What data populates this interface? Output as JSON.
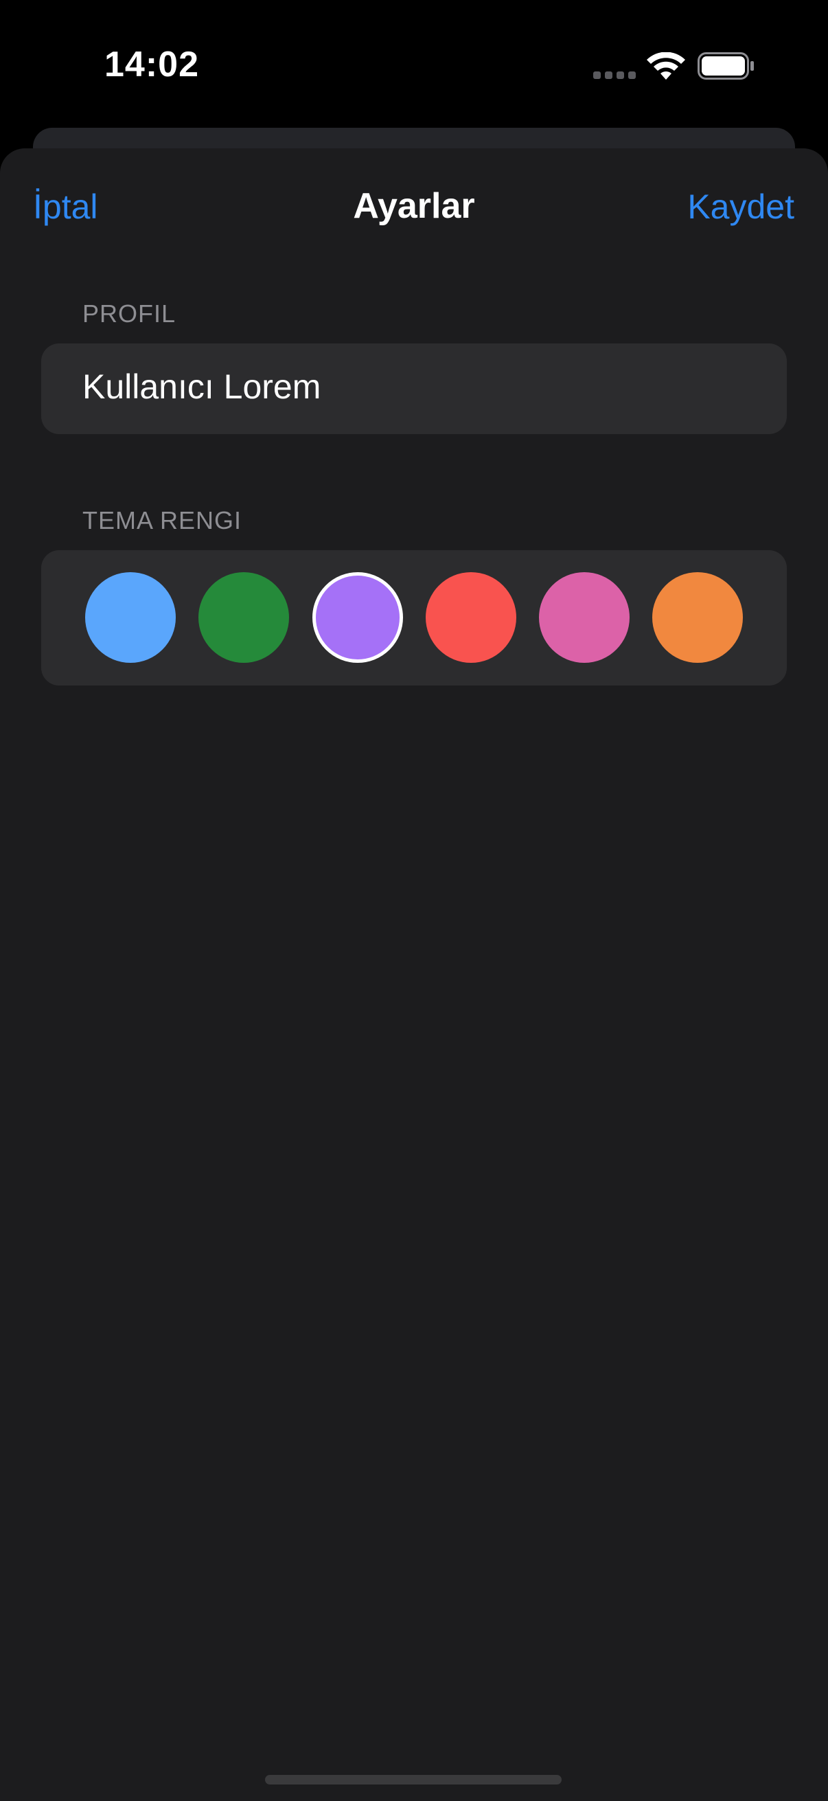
{
  "status_bar": {
    "time": "14:02",
    "signal_icon": "cellular-signal-icon",
    "wifi_icon": "wifi-icon",
    "battery_icon": "battery-icon"
  },
  "nav": {
    "cancel_label": "İptal",
    "title": "Ayarlar",
    "save_label": "Kaydet",
    "accent_color": "#2f88f2"
  },
  "profile": {
    "section_label": "PROFIL",
    "name_value": "Kullanıcı Lorem"
  },
  "theme": {
    "section_label": "TEMA RENGI",
    "selected_index": 2,
    "colors": [
      {
        "name": "blue",
        "hex": "#5aa6fc"
      },
      {
        "name": "green",
        "hex": "#258a3a"
      },
      {
        "name": "purple",
        "hex": "#a571f7"
      },
      {
        "name": "red",
        "hex": "#f9534f"
      },
      {
        "name": "pink",
        "hex": "#dc62a8"
      },
      {
        "name": "orange",
        "hex": "#f1883f"
      }
    ]
  }
}
